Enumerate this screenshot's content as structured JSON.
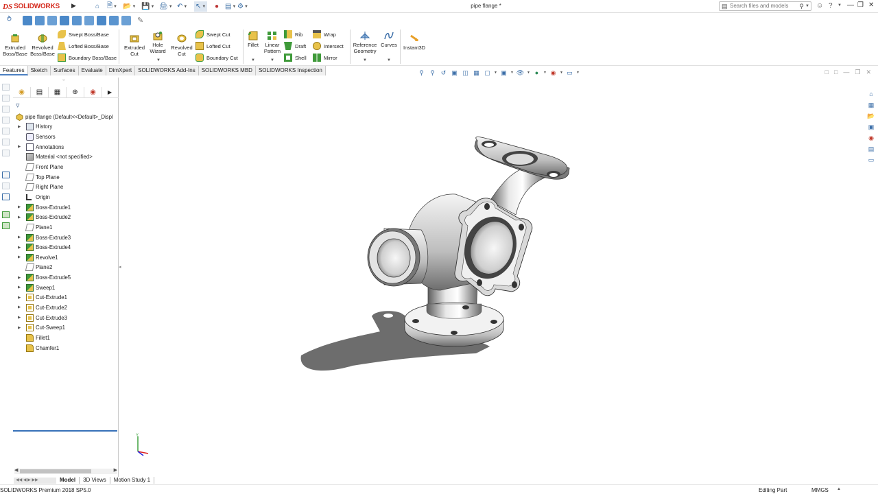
{
  "app": {
    "logo_ds": "DS",
    "logo_text": "SOLIDWORKS",
    "document_title": "pipe flange *",
    "search_placeholder": "Search files and models"
  },
  "command_manager": {
    "features": [
      {
        "label": "Extruded\nBoss/Base",
        "icon": "extruded-boss-icon"
      },
      {
        "label": "Revolved\nBoss/Base",
        "icon": "revolved-boss-icon"
      }
    ],
    "boss_rows": [
      "Swept Boss/Base",
      "Lofted Boss/Base",
      "Boundary Boss/Base"
    ],
    "cut_buttons": [
      {
        "label": "Extruded\nCut"
      },
      {
        "label": "Hole\nWizard"
      },
      {
        "label": "Revolved\nCut"
      }
    ],
    "cut_rows": [
      "Swept Cut",
      "Lofted Cut",
      "Boundary Cut"
    ],
    "fillet_label": "Fillet",
    "linear_pattern_label": "Linear\nPattern",
    "misc_rows_a": [
      "Rib",
      "Draft",
      "Shell"
    ],
    "misc_rows_b": [
      "Wrap",
      "Intersect",
      "Mirror"
    ],
    "ref_geom_label": "Reference\nGeometry",
    "curves_label": "Curves",
    "instant3d_label": "Instant3D"
  },
  "tabs": [
    "Features",
    "Sketch",
    "Surfaces",
    "Evaluate",
    "DimXpert",
    "SOLIDWORKS Add-Ins",
    "SOLIDWORKS MBD",
    "SOLIDWORKS Inspection"
  ],
  "active_tab": "Features",
  "feature_tree": {
    "root": "pipe flange  (Default<<Default>_Displ",
    "items": [
      {
        "label": "History",
        "expandable": true
      },
      {
        "label": "Sensors",
        "expandable": false
      },
      {
        "label": "Annotations",
        "expandable": true
      },
      {
        "label": "Material <not specified>",
        "expandable": false
      },
      {
        "label": "Front Plane",
        "expandable": false
      },
      {
        "label": "Top Plane",
        "expandable": false
      },
      {
        "label": "Right Plane",
        "expandable": false
      },
      {
        "label": "Origin",
        "expandable": false
      },
      {
        "label": "Boss-Extrude1",
        "expandable": true
      },
      {
        "label": "Boss-Extrude2",
        "expandable": true
      },
      {
        "label": "Plane1",
        "expandable": false
      },
      {
        "label": "Boss-Extrude3",
        "expandable": true
      },
      {
        "label": "Boss-Extrude4",
        "expandable": true
      },
      {
        "label": "Revolve1",
        "expandable": true
      },
      {
        "label": "Plane2",
        "expandable": false
      },
      {
        "label": "Boss-Extrude5",
        "expandable": true
      },
      {
        "label": "Sweep1",
        "expandable": true
      },
      {
        "label": "Cut-Extrude1",
        "expandable": true
      },
      {
        "label": "Cut-Extrude2",
        "expandable": true
      },
      {
        "label": "Cut-Extrude3",
        "expandable": true
      },
      {
        "label": "Cut-Sweep1",
        "expandable": true
      },
      {
        "label": "Fillet1",
        "expandable": false
      },
      {
        "label": "Chamfer1",
        "expandable": false
      }
    ]
  },
  "bottom_tabs": [
    "Model",
    "3D Views",
    "Motion Study 1"
  ],
  "status": {
    "left": "SOLIDWORKS Premium 2018 SP5.0",
    "mode": "Editing Part",
    "units": "MMGS"
  },
  "colors": {
    "accent": "#3670b8",
    "brand_red": "#d52b1e",
    "icon_yellow": "#e8c24a",
    "icon_green": "#3f9a3a"
  }
}
